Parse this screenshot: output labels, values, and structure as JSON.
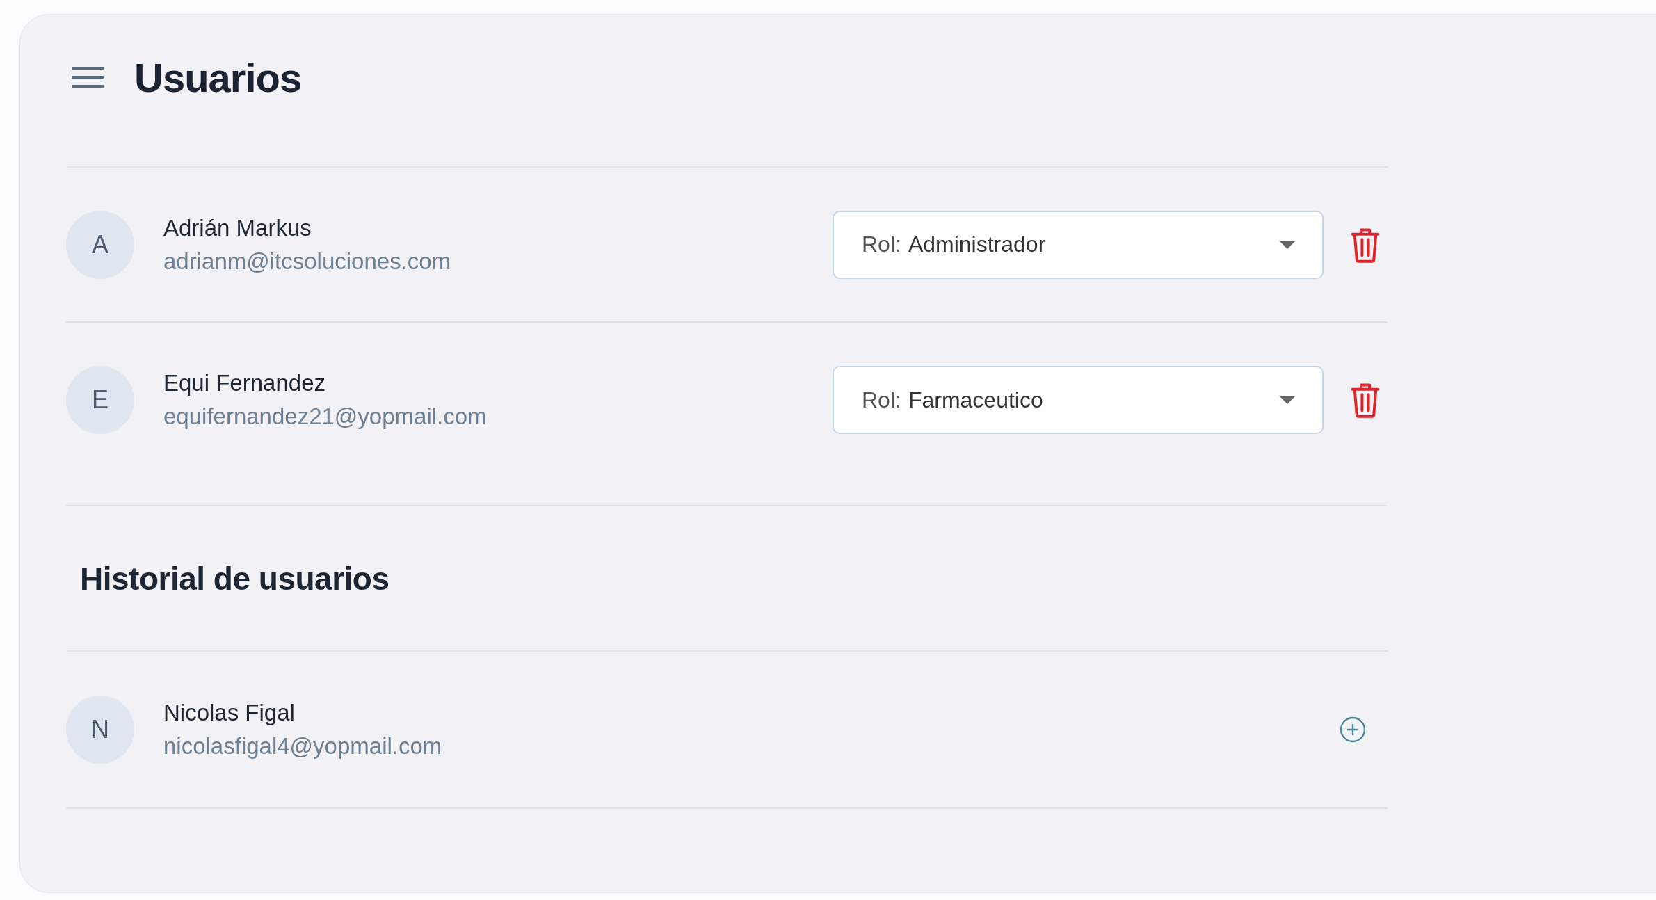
{
  "header": {
    "title": "Usuarios"
  },
  "users": [
    {
      "initial": "A",
      "name": "Adrián Markus",
      "email": "adrianm@itcsoluciones.com",
      "role_label": "Rol:",
      "role": "Administrador"
    },
    {
      "initial": "E",
      "name": "Equi Fernandez",
      "email": "equifernandez21@yopmail.com",
      "role_label": "Rol:",
      "role": "Farmaceutico"
    }
  ],
  "history": {
    "title": "Historial de usuarios",
    "users": [
      {
        "initial": "N",
        "name": "Nicolas Figal",
        "email": "nicolasfigal4@yopmail.com"
      }
    ]
  }
}
